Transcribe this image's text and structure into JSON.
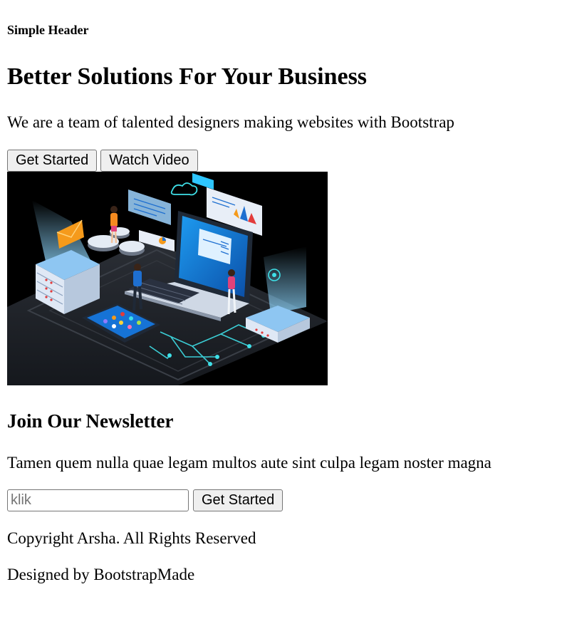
{
  "header": {
    "title": "Simple Header"
  },
  "hero": {
    "title": "Better Solutions For Your Business",
    "subtitle": "We are a team of talented designers making websites with Bootstrap",
    "get_started_label": "Get Started",
    "watch_video_label": "Watch Video"
  },
  "illustration": {
    "icon": "isometric-datacenter-laptop-illustration",
    "colors": {
      "background": "#000000",
      "accent": "#1e9bf0",
      "glow": "#3fe0e8",
      "server": "#dfe8f5",
      "envelope": "#f59a1b"
    }
  },
  "newsletter": {
    "title": "Join Our Newsletter",
    "subtitle": "Tamen quem nulla quae legam multos aute sint culpa legam noster magna",
    "input_placeholder": "klik",
    "input_value": "",
    "submit_label": "Get Started"
  },
  "footer": {
    "copyright": "Copyright Arsha. All Rights Reserved",
    "credits": "Designed by BootstrapMade"
  }
}
